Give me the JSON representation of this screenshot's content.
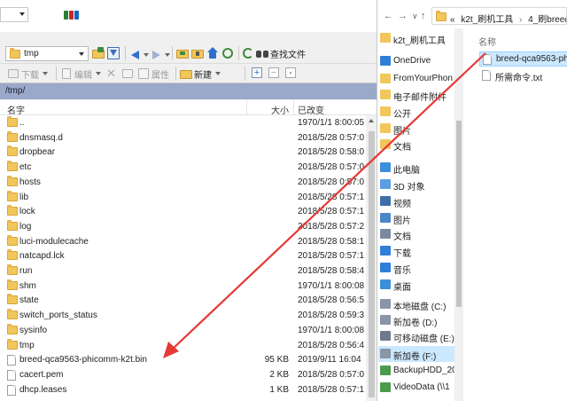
{
  "left_pane": {
    "path_combo": "tmp",
    "toolbar1": {
      "find_files_label": "查找文件"
    },
    "toolbar2": {
      "download_label": "下载",
      "edit_label": "编辑",
      "properties_label": "属性",
      "new_label": "新建"
    },
    "current_path": "/tmp/",
    "columns": {
      "name": "名字",
      "size": "大小",
      "modified": "已改变"
    },
    "files": [
      {
        "name": "..",
        "size": "",
        "modified": "1970/1/1 8:00:05",
        "kind": "parent"
      },
      {
        "name": "dnsmasq.d",
        "size": "",
        "modified": "2018/5/28 0:57:0",
        "kind": "folder"
      },
      {
        "name": "dropbear",
        "size": "",
        "modified": "2018/5/28 0:58:0",
        "kind": "folder"
      },
      {
        "name": "etc",
        "size": "",
        "modified": "2018/5/28 0:57:0",
        "kind": "folder"
      },
      {
        "name": "hosts",
        "size": "",
        "modified": "2018/5/28 0:57:0",
        "kind": "folder"
      },
      {
        "name": "lib",
        "size": "",
        "modified": "2018/5/28 0:57:1",
        "kind": "folder"
      },
      {
        "name": "lock",
        "size": "",
        "modified": "2018/5/28 0:57:1",
        "kind": "folder"
      },
      {
        "name": "log",
        "size": "",
        "modified": "2018/5/28 0:57:2",
        "kind": "folder"
      },
      {
        "name": "luci-modulecache",
        "size": "",
        "modified": "2018/5/28 0:58:1",
        "kind": "folder"
      },
      {
        "name": "natcapd.lck",
        "size": "",
        "modified": "2018/5/28 0:57:1",
        "kind": "folder"
      },
      {
        "name": "run",
        "size": "",
        "modified": "2018/5/28 0:58:4",
        "kind": "folder"
      },
      {
        "name": "shm",
        "size": "",
        "modified": "1970/1/1 8:00:08",
        "kind": "folder"
      },
      {
        "name": "state",
        "size": "",
        "modified": "2018/5/28 0:56:5",
        "kind": "folder"
      },
      {
        "name": "switch_ports_status",
        "size": "",
        "modified": "2018/5/28 0:59:3",
        "kind": "folder"
      },
      {
        "name": "sysinfo",
        "size": "",
        "modified": "1970/1/1 8:00:08",
        "kind": "folder"
      },
      {
        "name": "tmp",
        "size": "",
        "modified": "2018/5/28 0:56:4",
        "kind": "folder"
      },
      {
        "name": "breed-qca9563-phicomm-k2t.bin",
        "size": "95 KB",
        "modified": "2019/9/11 16:04",
        "kind": "file"
      },
      {
        "name": "cacert.pem",
        "size": "2 KB",
        "modified": "2018/5/28 0:57:0",
        "kind": "file"
      },
      {
        "name": "dhcp.leases",
        "size": "1 KB",
        "modified": "2018/5/28 0:57:1",
        "kind": "file"
      }
    ]
  },
  "right_pane": {
    "breadcrumb": [
      "«",
      "k2t_刷机工具",
      "›",
      "4_刷breed"
    ],
    "nav_items": [
      {
        "label": "k2t_刷机工具",
        "icon": "folder-icon"
      },
      {
        "label": "OneDrive",
        "icon": "cloud-icon"
      },
      {
        "label": "FromYourPhon",
        "icon": "folder-icon"
      },
      {
        "label": "电子邮件附件",
        "icon": "folder-icon"
      },
      {
        "label": "公开",
        "icon": "folder-icon"
      },
      {
        "label": "图片",
        "icon": "folder-icon"
      },
      {
        "label": "文档",
        "icon": "folder-icon"
      },
      {
        "label": "此电脑",
        "icon": "computer-icon"
      },
      {
        "label": "3D 对象",
        "icon": "cube-icon"
      },
      {
        "label": "视频",
        "icon": "video-icon"
      },
      {
        "label": "图片",
        "icon": "picture-icon"
      },
      {
        "label": "文档",
        "icon": "document-icon"
      },
      {
        "label": "下载",
        "icon": "download-icon"
      },
      {
        "label": "音乐",
        "icon": "music-icon"
      },
      {
        "label": "桌面",
        "icon": "desktop-icon"
      },
      {
        "label": "本地磁盘 (C:)",
        "icon": "drive-icon"
      },
      {
        "label": "新加卷 (D:)",
        "icon": "drive-icon"
      },
      {
        "label": "可移动磁盘 (E:)",
        "icon": "usb-drive-icon"
      },
      {
        "label": "新加卷 (F:)",
        "icon": "drive-icon"
      },
      {
        "label": "BackupHDD_20",
        "icon": "network-drive-icon"
      },
      {
        "label": "VideoData (\\\\1",
        "icon": "network-drive-icon"
      }
    ],
    "content_header": "名称",
    "files": [
      {
        "name": "breed-qca9563-phicomm-k2t.bin",
        "selected": true
      },
      {
        "name": "所需命令.txt",
        "selected": false
      }
    ]
  },
  "colors": {
    "path_bar": "#9aa9c9",
    "folder": "#f1c65b",
    "selection": "#cce8ff",
    "arrow": "#e53935"
  }
}
